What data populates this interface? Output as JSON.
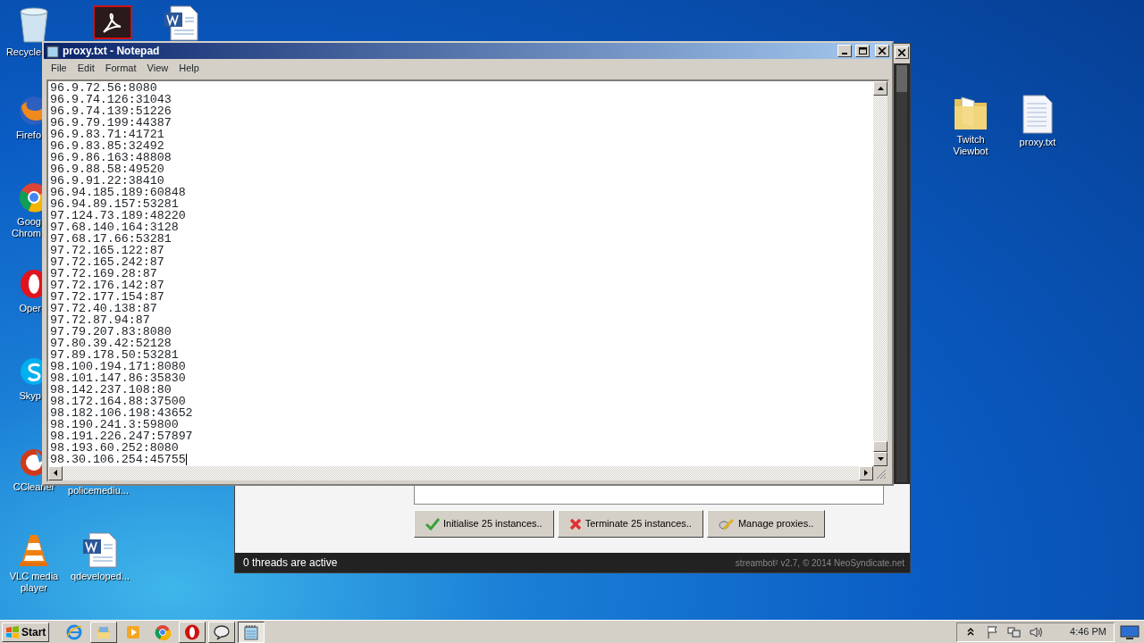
{
  "desktop_icons": [
    {
      "kind": "recycle",
      "label": "Recycle"
    },
    {
      "kind": "acrobat"
    },
    {
      "kind": "word"
    },
    {
      "kind": "firefox",
      "label": "Firefo"
    },
    {
      "kind": "chrome",
      "label": "Goog\nChrom"
    },
    {
      "kind": "opera",
      "label": "Oper"
    },
    {
      "kind": "skype",
      "label": "Skyp"
    },
    {
      "kind": "ccleaner",
      "label": "CCleaner"
    },
    {
      "kind": "none",
      "label": "policemediu..."
    },
    {
      "kind": "vlc",
      "label": "VLC media\nplayer"
    },
    {
      "kind": "word",
      "label": "qdeveloped..."
    },
    {
      "kind": "folder",
      "label": "Twitch\nViewbot"
    },
    {
      "kind": "textfile",
      "label": "proxy.txt"
    }
  ],
  "streambot": {
    "buttons": [
      {
        "kind": "check",
        "label": "Initialise 25 instances.."
      },
      {
        "kind": "cross",
        "label": "Terminate 25 instances.."
      },
      {
        "kind": "proxy",
        "label": "Manage proxies.."
      }
    ],
    "status": "0 threads are active",
    "credit": "streambot² v2.7, © 2014 NeoSyndicate.net"
  },
  "notepad": {
    "title": "proxy.txt - Notepad",
    "menu": [
      "File",
      "Edit",
      "Format",
      "View",
      "Help"
    ],
    "lines": [
      "96.9.72.56:8080",
      "96.9.74.126:31043",
      "96.9.74.139:51226",
      "96.9.79.199:44387",
      "96.9.83.71:41721",
      "96.9.83.85:32492",
      "96.9.86.163:48808",
      "96.9.88.58:49520",
      "96.9.91.22:38410",
      "96.94.185.189:60848",
      "96.94.89.157:53281",
      "97.124.73.189:48220",
      "97.68.140.164:3128",
      "97.68.17.66:53281",
      "97.72.165.122:87",
      "97.72.165.242:87",
      "97.72.169.28:87",
      "97.72.176.142:87",
      "97.72.177.154:87",
      "97.72.40.138:87",
      "97.72.87.94:87",
      "97.79.207.83:8080",
      "97.80.39.42:52128",
      "97.89.178.50:53281",
      "98.100.194.171:8080",
      "98.101.147.86:35830",
      "98.142.237.108:80",
      "98.172.164.88:37500",
      "98.182.106.198:43652",
      "98.190.241.3:59800",
      "98.191.226.247:57897",
      "98.193.60.252:8080",
      "98.30.106.254:45755"
    ]
  },
  "taskbar": {
    "start": "Start",
    "apps": [
      {
        "kind": "ie",
        "active": false
      },
      {
        "kind": "explorer",
        "active": false
      },
      {
        "kind": "media",
        "active": false
      },
      {
        "kind": "chrome",
        "active": false
      },
      {
        "kind": "opera",
        "active": false
      },
      {
        "kind": "chat",
        "active": false
      },
      {
        "kind": "notepad",
        "active": true
      }
    ],
    "tray": [
      {
        "kind": "expand"
      },
      {
        "kind": "flag"
      },
      {
        "kind": "network"
      },
      {
        "kind": "volume"
      }
    ],
    "time": "4:46 PM"
  }
}
